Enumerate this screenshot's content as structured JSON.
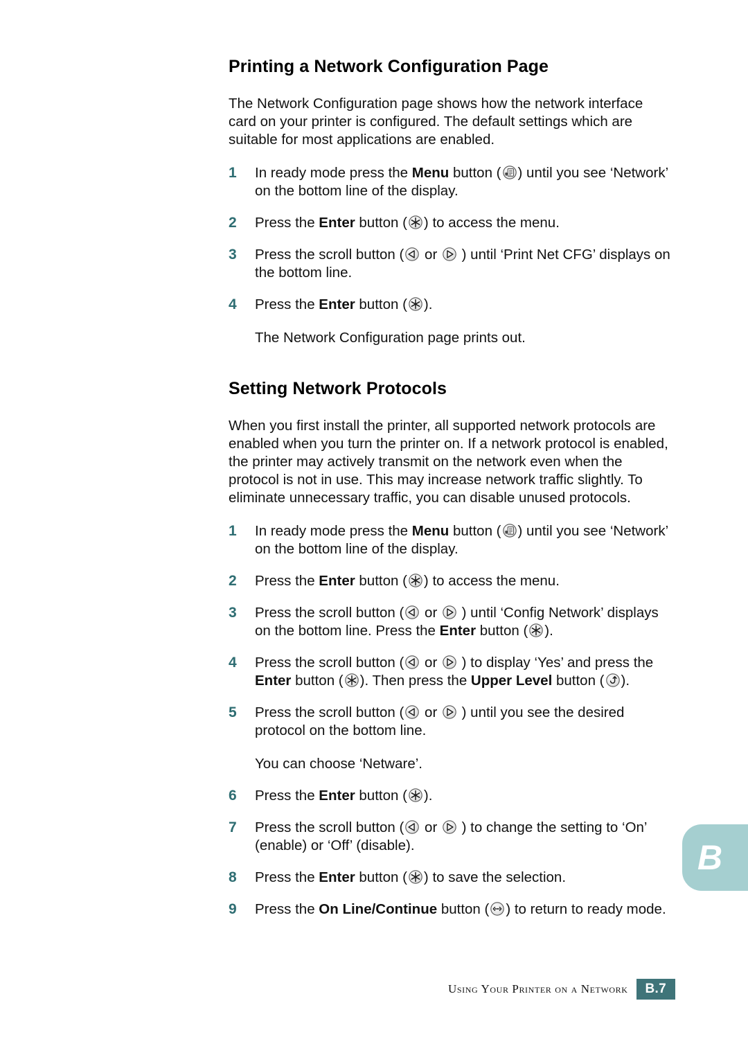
{
  "page": {
    "accent_teal": "#2e6d72",
    "badge_teal": "#3f7479",
    "tab_teal": "#a5cfd0"
  },
  "sections": [
    {
      "heading": "Printing a Network Configuration Page",
      "intro": "The Network Configuration page shows how the network interface card on your printer is configured. The default settings which are suitable for most applications are enabled."
    },
    {
      "heading": "Setting Network Protocols",
      "intro": "When you first install the printer, all supported network protocols are enabled when you turn the printer on. If a network protocol is enabled, the printer may actively transmit on the network even when the protocol is not in use. This may increase network traffic slightly. To eliminate unnecessary traffic, you can disable unused protocols."
    }
  ],
  "steps_a": {
    "s1": {
      "num": "1",
      "t1": "In ready mode press the ",
      "b1": "Menu",
      "t2": " button (",
      "t3": ") until you see ‘Network’ on the bottom line of the display."
    },
    "s2": {
      "num": "2",
      "t1": "Press the ",
      "b1": "Enter",
      "t2": " button (",
      "t3": ") to access the menu."
    },
    "s3": {
      "num": "3",
      "t1": "Press the scroll button (",
      "t2": " or ",
      "t3": " ) until ‘Print Net CFG’ displays on the bottom line."
    },
    "s4": {
      "num": "4",
      "t1": "Press the ",
      "b1": "Enter",
      "t2": " button (",
      "t3": ")."
    },
    "note": "The Network Configuration page prints out."
  },
  "steps_b": {
    "s1": {
      "num": "1",
      "t1": "In ready mode press the ",
      "b1": "Menu",
      "t2": " button (",
      "t3": ") until you see ‘Network’ on the bottom line of the display."
    },
    "s2": {
      "num": "2",
      "t1": "Press the ",
      "b1": "Enter",
      "t2": " button (",
      "t3": ") to access the menu."
    },
    "s3": {
      "num": "3",
      "t1": "Press the scroll button (",
      "t2": " or ",
      "t3": " ) until ‘Config Network’ displays on the bottom line. Press the ",
      "b1": "Enter",
      "t4": " button (",
      "t5": ")."
    },
    "s4": {
      "num": "4",
      "t1": "Press the scroll button (",
      "t2": " or ",
      "t3": " ) to display ‘Yes’ and press the ",
      "b1": "Enter",
      "t4": " button (",
      "t5": "). Then press the ",
      "b2": "Upper Level",
      "t6": " button (",
      "t7": ")."
    },
    "s5": {
      "num": "5",
      "t1": "Press the scroll button (",
      "t2": " or ",
      "t3": " ) until you see the desired protocol on the bottom line."
    },
    "note": "You can choose ‘Netware’.",
    "s6": {
      "num": "6",
      "t1": "Press the ",
      "b1": "Enter",
      "t2": " button (",
      "t3": ")."
    },
    "s7": {
      "num": "7",
      "t1": "Press the scroll button (",
      "t2": " or ",
      "t3": " ) to change the setting to ‘On’ (enable) or ‘Off’ (disable)."
    },
    "s8": {
      "num": "8",
      "t1": "Press the ",
      "b1": "Enter",
      "t2": " button (",
      "t3": ") to save the selection."
    },
    "s9": {
      "num": "9",
      "t1": "Press the ",
      "b1": "On Line/Continue",
      "t2": " button (",
      "t3": ") to return to ready mode."
    }
  },
  "side_tab": {
    "letter": "B"
  },
  "footer": {
    "title": "Using Your Printer on a Network",
    "page_number": "B.7"
  },
  "icons": {
    "menu": "menu-button-icon",
    "enter": "enter-button-icon",
    "scroll_left": "scroll-left-button-icon",
    "scroll_right": "scroll-right-button-icon",
    "upper_level": "upper-level-button-icon",
    "online": "on-line-continue-button-icon"
  }
}
